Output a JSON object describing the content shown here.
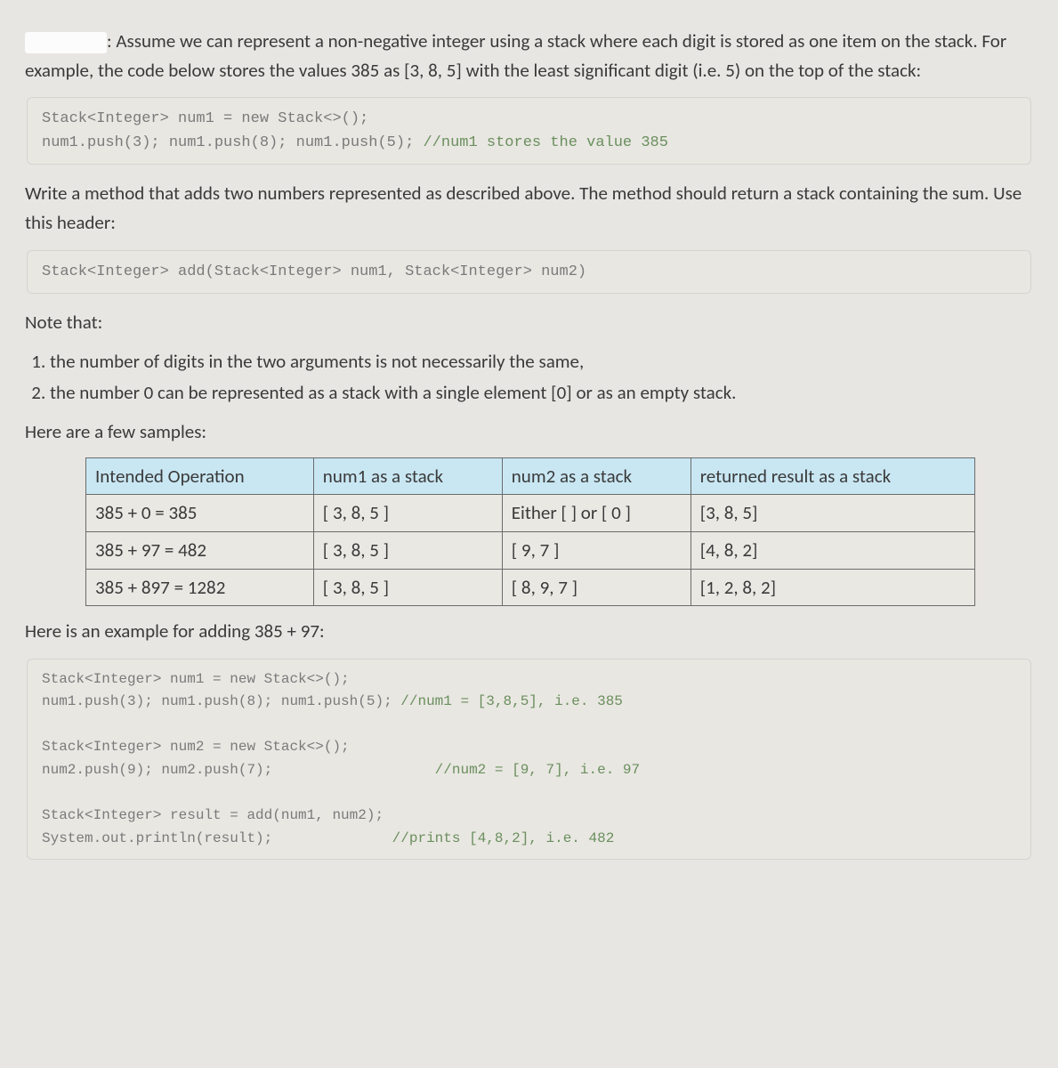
{
  "intro": {
    "label_suffix": ": Assume we can represent a non-negative integer using a stack where each digit is stored as one item on the stack. For example, the code below stores the values 385 as [3, 8, 5] with the least significant digit (i.e. 5) on the top of the stack:"
  },
  "code1": {
    "line1": "Stack<Integer> num1 = new Stack<>();",
    "line2a": "num1.push(3); num1.push(8); num1.push(5); ",
    "line2b": "//num1 stores the value 385"
  },
  "para2": "Write a method that adds two numbers represented as described above. The method should return a stack containing the sum. Use this header:",
  "code2": {
    "line1": "Stack<Integer> add(Stack<Integer> num1, Stack<Integer> num2)"
  },
  "note_label": "Note that:",
  "notes": {
    "n1": "the number of digits in the two arguments is not necessarily the same,",
    "n2": "the number 0 can be represented as a stack with a single element [0] or as an empty stack."
  },
  "samples_label": "Here are a few samples:",
  "table": {
    "h1": "Intended Operation",
    "h2": "num1 as a stack",
    "h3": "num2 as a stack",
    "h4": "returned result as a stack",
    "rows": [
      {
        "c1": "385 + 0 = 385",
        "c2": "[ 3, 8, 5 ]",
        "c3": "Either [ ] or [ 0 ]",
        "c4": "[3, 8, 5]"
      },
      {
        "c1": "385 + 97 = 482",
        "c2": "[ 3, 8, 5 ]",
        "c3": "[ 9, 7 ]",
        "c4": "[4, 8, 2]"
      },
      {
        "c1": "385 + 897 = 1282",
        "c2": "[ 3, 8, 5 ]",
        "c3": "[ 8, 9, 7 ]",
        "c4": "[1, 2, 8, 2]"
      }
    ]
  },
  "example_label": "Here is an example for adding 385 + 97:",
  "code3": {
    "l1": "Stack<Integer> num1 = new Stack<>();",
    "l2a": "num1.push(3); num1.push(8); num1.push(5); ",
    "l2b": "//num1 = [3,8,5], i.e. 385",
    "l3": "",
    "l4": "Stack<Integer> num2 = new Stack<>();",
    "l5a": "num2.push(9); num2.push(7);                   ",
    "l5b": "//num2 = [9, 7], i.e. 97",
    "l6": "",
    "l7": "Stack<Integer> result = add(num1, num2);",
    "l8a": "System.out.println(result);              ",
    "l8b": "//prints [4,8,2], i.e. 482"
  }
}
